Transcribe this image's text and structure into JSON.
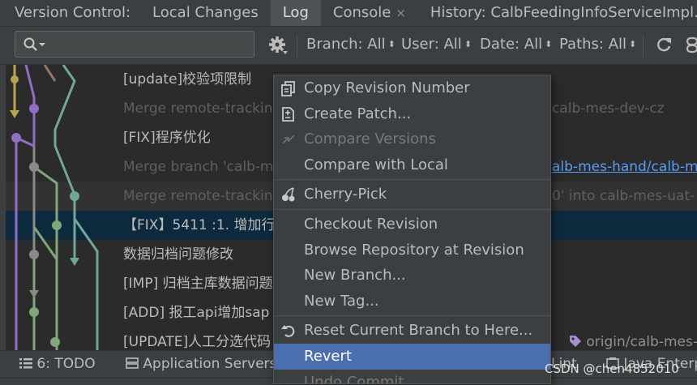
{
  "tabs": {
    "version_control": "Version Control:",
    "local_changes": "Local Changes",
    "log": "Log",
    "console": "Console",
    "console_close": "×",
    "history": "History: CalbFeedingInfoServiceImpl.ja"
  },
  "toolbar": {
    "search_placeholder": "",
    "branch": "Branch: All",
    "user": "User: All",
    "date": "Date: All",
    "paths": "Paths: All",
    "dropdown_arrow": "⬍"
  },
  "commits": [
    {
      "message": "[update]校验项限制",
      "dim": false,
      "right": ""
    },
    {
      "message": "Merge remote-trackin",
      "dim": true,
      "right": "calb-mes-dev-cz"
    },
    {
      "message": "[FIX]程序优化",
      "dim": false,
      "right": ""
    },
    {
      "message": "Merge branch 'calb-m",
      "dim": true,
      "right": "alb-mes-hand/calb-m"
    },
    {
      "message": "Merge remote-trackin",
      "dim": true,
      "right": "0' into calb-mes-uat-"
    },
    {
      "message": "【FIX】5411 :1. 增加行",
      "dim": false,
      "right": ""
    },
    {
      "message": "数据归档问题修改",
      "dim": false,
      "right": ""
    },
    {
      "message": "[IMP] 归档主库数据问题",
      "dim": false,
      "right": ""
    },
    {
      "message": "[ADD] 报工api增加sap",
      "dim": false,
      "right": ""
    },
    {
      "message": "[UPDATE]人工分选代码",
      "dim": false,
      "right": ""
    }
  ],
  "ref_label": "origin/calb-mes-",
  "context_menu": {
    "items": [
      {
        "label": "Copy Revision Number",
        "icon": "copy-icon",
        "disabled": false
      },
      {
        "label": "Create Patch...",
        "icon": "patch-icon",
        "disabled": false
      },
      {
        "label": "Compare Versions",
        "icon": "compare-arrows-icon",
        "disabled": true
      },
      {
        "label": "Compare with Local",
        "icon": "",
        "disabled": false
      },
      {
        "label": "Cherry-Pick",
        "icon": "cherry-icon",
        "disabled": false
      },
      {
        "label": "Checkout Revision",
        "icon": "",
        "disabled": false
      },
      {
        "label": "Browse Repository at Revision",
        "icon": "",
        "disabled": false
      },
      {
        "label": "New Branch...",
        "icon": "",
        "disabled": false
      },
      {
        "label": "New Tag...",
        "icon": "",
        "disabled": false
      },
      {
        "label": "Reset Current Branch to Here...",
        "icon": "reset-icon",
        "disabled": false
      },
      {
        "label": "Revert",
        "icon": "",
        "disabled": false,
        "selected": true
      },
      {
        "label": "Undo Commit",
        "icon": "",
        "disabled": true
      }
    ]
  },
  "bottom_bar": {
    "todo": "6: TODO",
    "app_servers": "Application Servers",
    "lint": "Lint",
    "java_enterprise": "Java Enterpr"
  },
  "watermark": "CSDN @chen4852010",
  "colors": {
    "selection": "#0d293e",
    "menu_selected": "#4b6eaf",
    "link": "#589df6",
    "branch_yellow": "#b8a450",
    "branch_purple": "#8e6fc4",
    "branch_green": "#7fa77a",
    "branch_teal": "#6fa898"
  }
}
